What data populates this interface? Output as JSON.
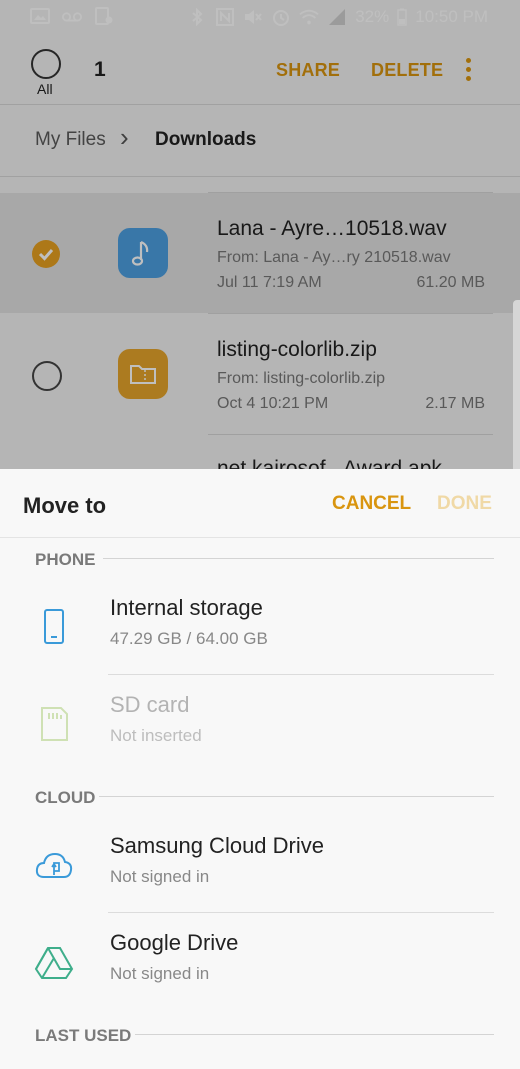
{
  "status_bar": {
    "battery": "32%",
    "time": "10:50 PM"
  },
  "toolbar": {
    "all_label": "All",
    "selected_count": "1",
    "share_label": "SHARE",
    "delete_label": "DELETE"
  },
  "breadcrumb": {
    "root": "My Files",
    "current": "Downloads"
  },
  "files": [
    {
      "name": "Lana - Ayre…10518.wav",
      "source": "From: Lana - Ay…ry 210518.wav",
      "date": "Jul 11 7:19 AM",
      "size": "61.20 MB",
      "selected": true
    },
    {
      "name": "listing-colorlib.zip",
      "source": "From: listing-colorlib.zip",
      "date": "Oct 4 10:21 PM",
      "size": "2.17 MB",
      "selected": false
    },
    {
      "name": "net.kairosof...Award.apk",
      "selected": false
    }
  ],
  "sheet": {
    "title": "Move to",
    "cancel_label": "CANCEL",
    "done_label": "DONE",
    "sections": {
      "phone": "PHONE",
      "cloud": "CLOUD",
      "last_used": "LAST USED"
    },
    "items": {
      "internal": {
        "title": "Internal storage",
        "sub": "47.29 GB / 64.00 GB"
      },
      "sdcard": {
        "title": "SD card",
        "sub": "Not inserted"
      },
      "samsung": {
        "title": "Samsung Cloud Drive",
        "sub": "Not signed in"
      },
      "gdrive": {
        "title": "Google Drive",
        "sub": "Not signed in"
      }
    }
  },
  "colors": {
    "accent": "#d9950f",
    "accent_disabled": "#f0d9a6",
    "music_icon": "#4d9fe0",
    "folder_icon": "#e6a52b"
  },
  "icons": [
    "image-icon",
    "voicemail-icon",
    "settings-icon",
    "bluetooth-icon",
    "nfc-icon",
    "mute-icon",
    "alarm-icon",
    "wifi-icon",
    "signal-icon",
    "battery-icon"
  ]
}
